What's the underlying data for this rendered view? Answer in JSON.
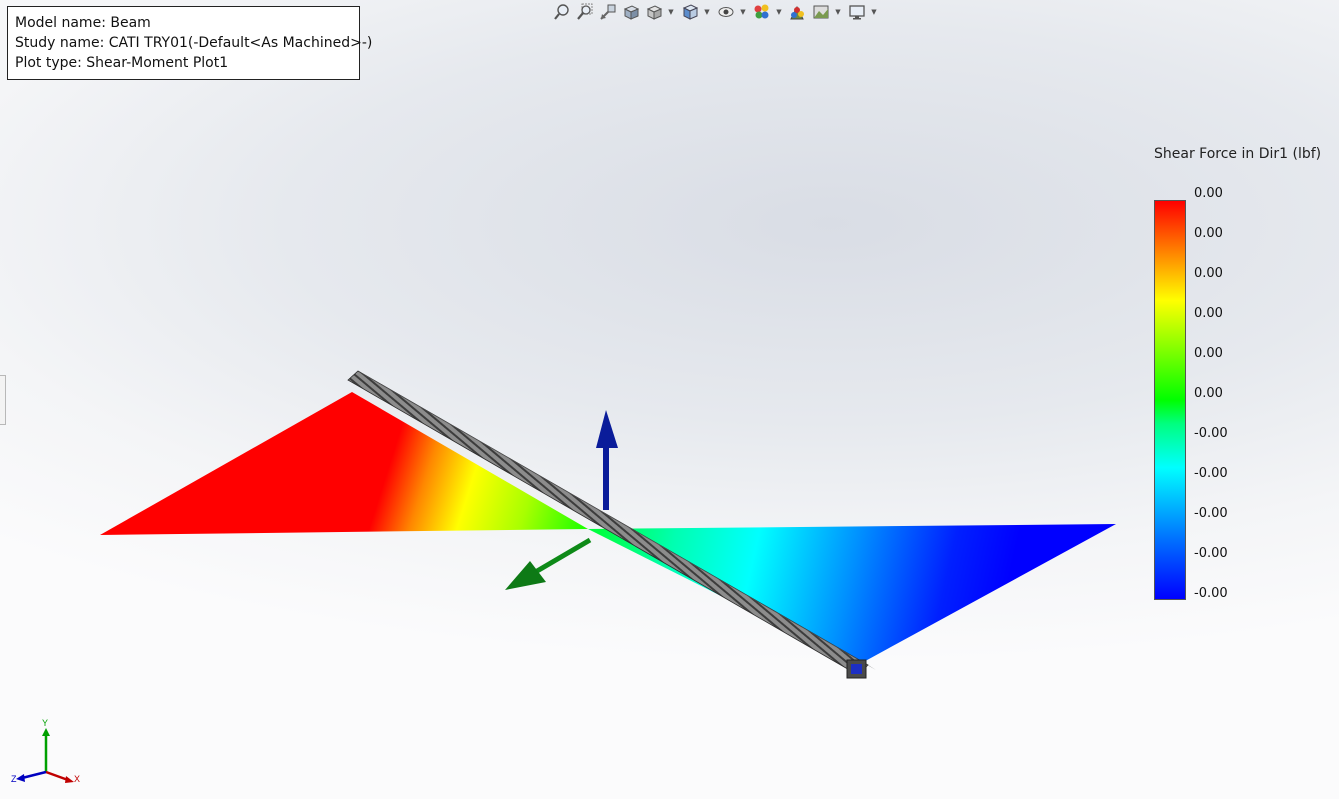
{
  "info": {
    "model": "Model name: Beam",
    "study": "Study name: CATI TRY01(-Default<As Machined>-)",
    "plot": "Plot type:  Shear-Moment Plot1"
  },
  "toolbar": {
    "buttons": [
      {
        "name": "zoom-to-fit-icon",
        "caret": false
      },
      {
        "name": "zoom-to-area-icon",
        "caret": false
      },
      {
        "name": "previous-view-icon",
        "caret": false
      },
      {
        "name": "section-view-icon",
        "caret": false
      },
      {
        "name": "dynamic-annotation-icon",
        "caret": true
      },
      {
        "name": "view-orientation-icon",
        "caret": true
      },
      {
        "name": "display-style-icon",
        "caret": true
      },
      {
        "name": "hide-show-items-icon",
        "caret": true
      },
      {
        "name": "edit-appearance-icon",
        "caret": false
      },
      {
        "name": "apply-scene-icon",
        "caret": true
      },
      {
        "name": "view-settings-icon",
        "caret": true
      }
    ]
  },
  "legend": {
    "title": "Shear Force in Dir1 (lbf)",
    "labels": [
      "0.00",
      "0.00",
      "0.00",
      "0.00",
      "0.00",
      "0.00",
      "-0.00",
      "-0.00",
      "-0.00",
      "-0.00",
      "-0.00"
    ],
    "colors": {
      "max": "#ff0000",
      "mid": "#00ff00",
      "min": "#0000ff"
    }
  },
  "triad": {
    "y_label": "Y",
    "x_label": "X",
    "z_label": "Z",
    "colors": {
      "x": "#c00000",
      "y": "#00a000",
      "z": "#0000c0"
    }
  },
  "arrows": {
    "vertical_color": "#0a1c9a",
    "horizontal_color": "#0e8a18"
  }
}
